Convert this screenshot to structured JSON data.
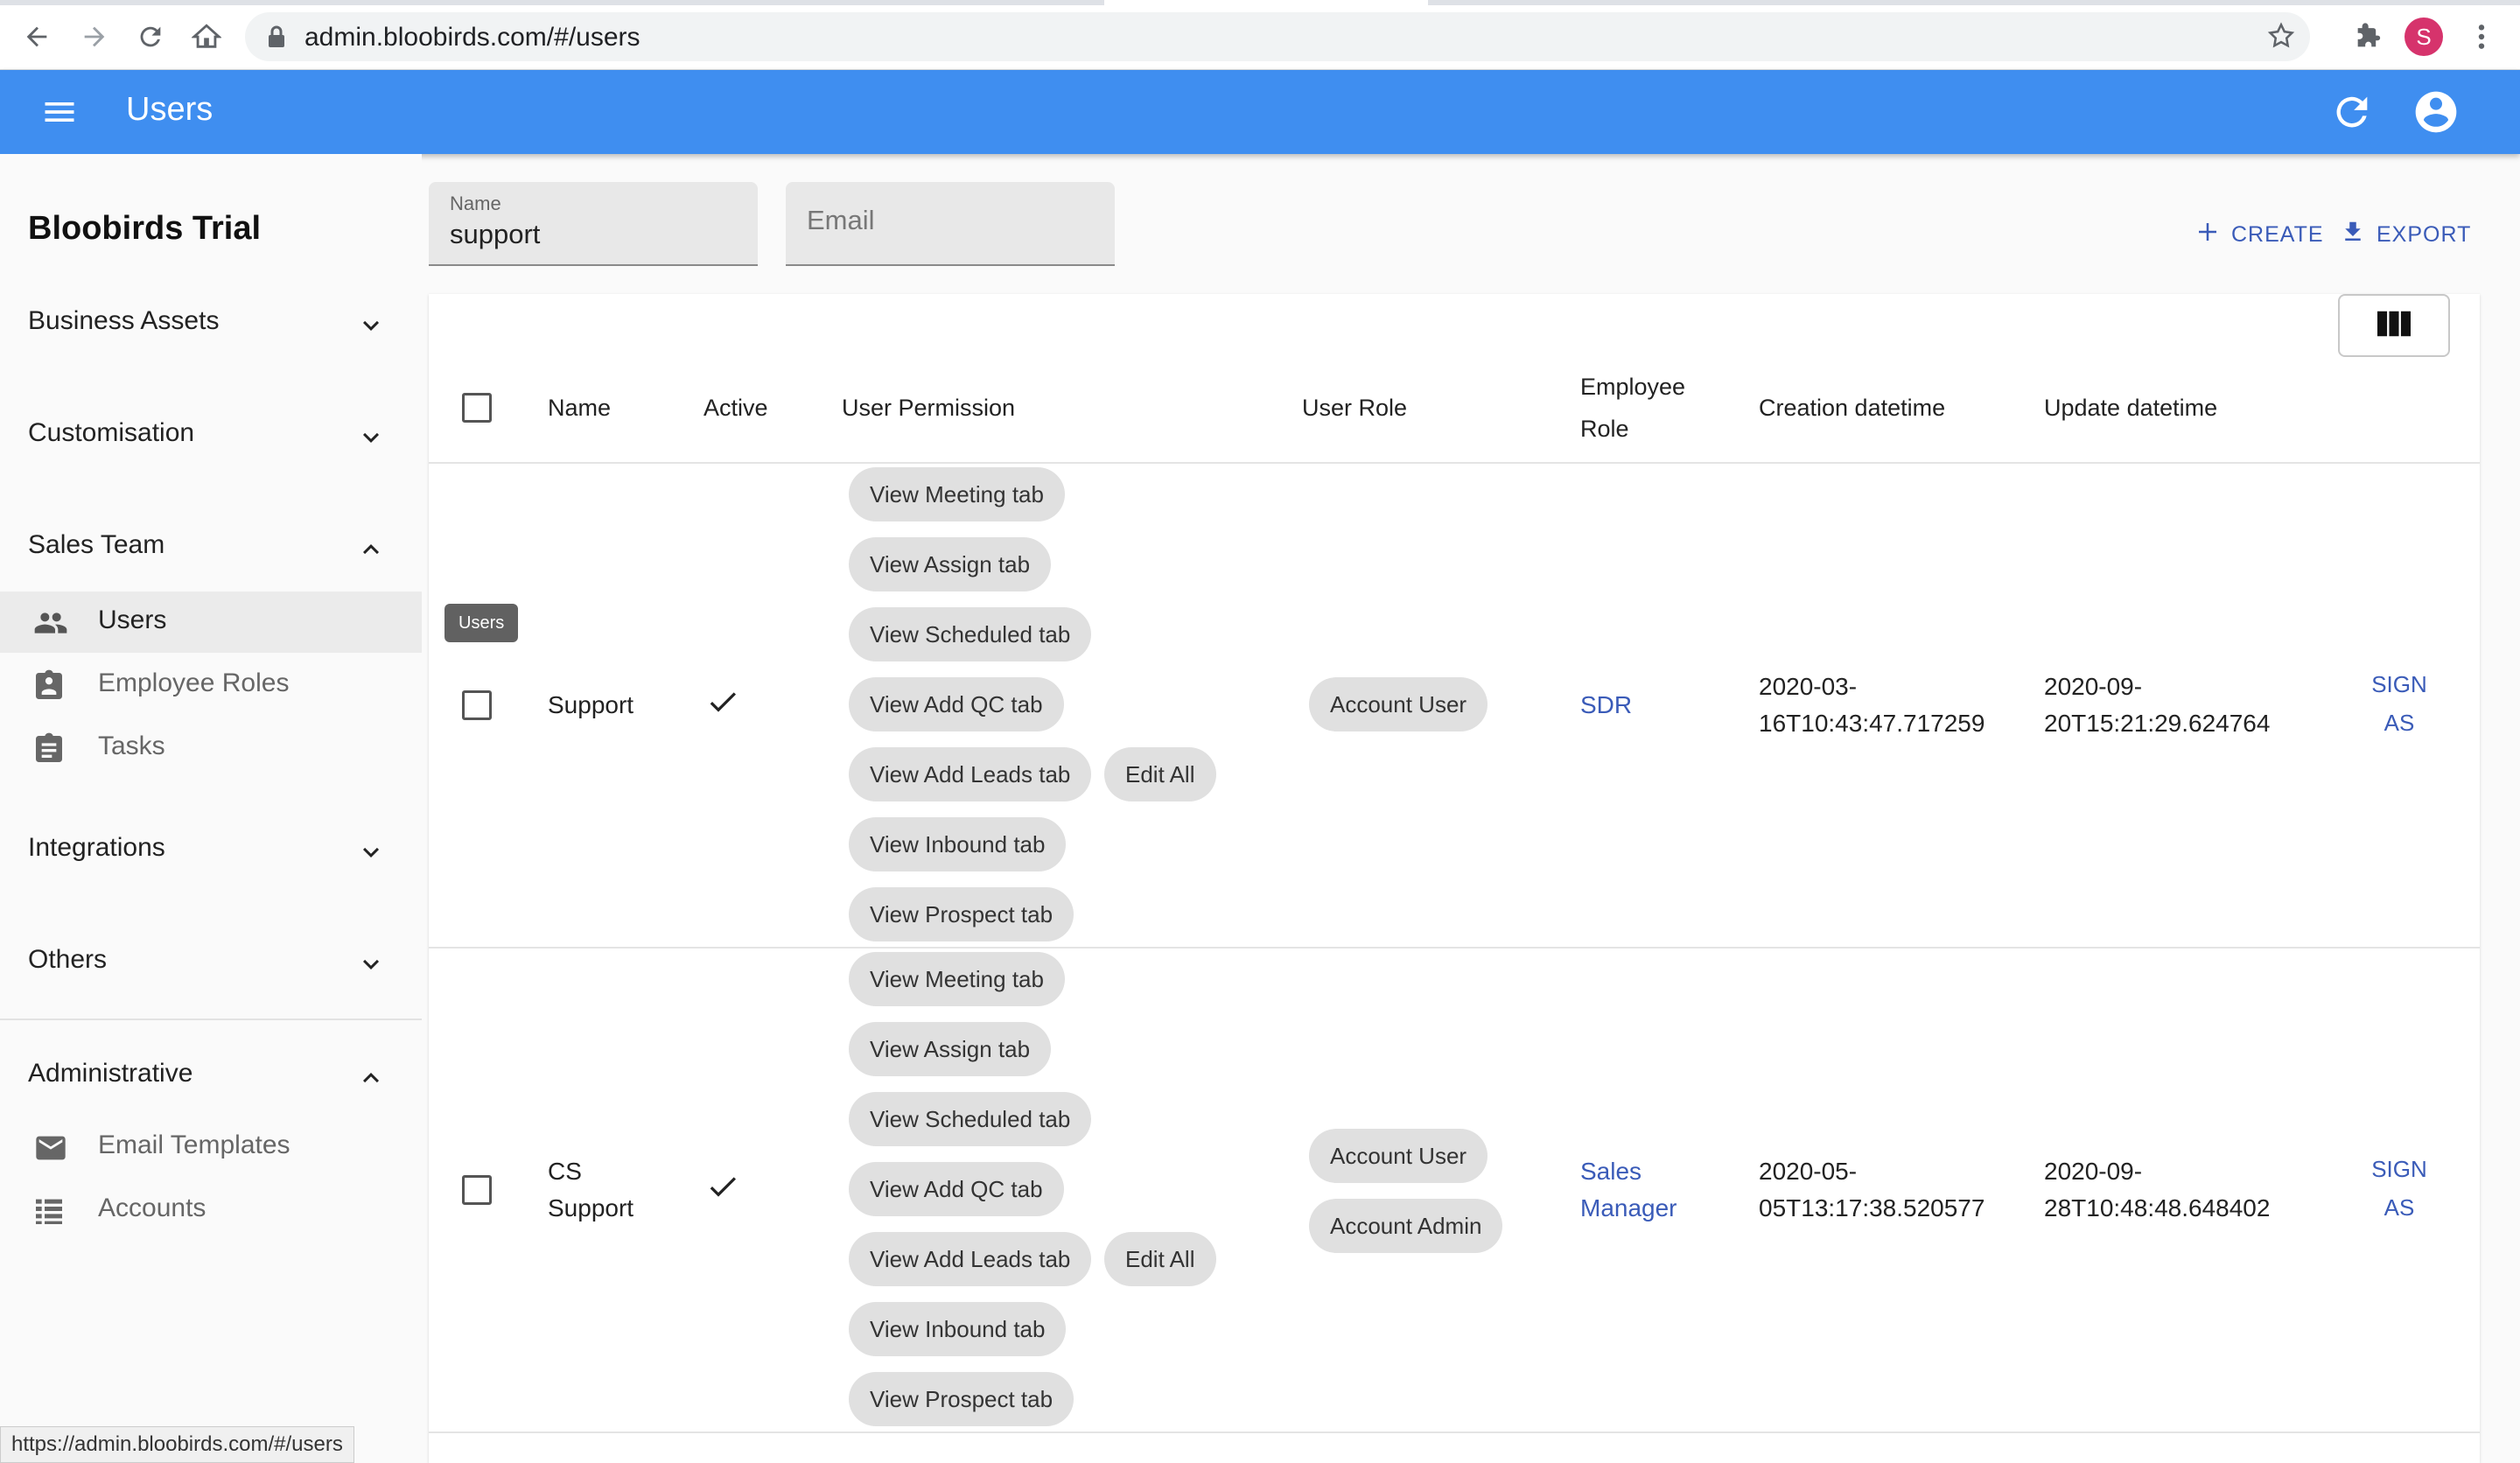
{
  "browser": {
    "url": "admin.bloobirds.com/#/users",
    "profile_initial": "S",
    "status_url": "https://admin.bloobirds.com/#/users"
  },
  "appbar": {
    "title": "Users"
  },
  "sidebar": {
    "brand": "Bloobirds Trial",
    "groups": {
      "business_assets": "Business Assets",
      "customisation": "Customisation",
      "sales_team": "Sales Team",
      "integrations": "Integrations",
      "others": "Others",
      "administrative": "Administrative"
    },
    "items": {
      "users": "Users",
      "employee_roles": "Employee Roles",
      "tasks": "Tasks",
      "email_templates": "Email Templates",
      "accounts": "Accounts"
    }
  },
  "filters": {
    "name_label": "Name",
    "name_value": "support",
    "email_placeholder": "Email"
  },
  "actions": {
    "create": "CREATE",
    "export": "EXPORT"
  },
  "table": {
    "headers": {
      "name": "Name",
      "active": "Active",
      "permission": "User Permission",
      "role": "User Role",
      "employee_role_1": "Employee",
      "employee_role_2": "Role",
      "created": "Creation datetime",
      "updated": "Update datetime"
    },
    "rows": [
      {
        "name_1": "Support",
        "active": true,
        "permissions": [
          "View Meeting tab",
          "View Assign tab",
          "View Scheduled tab",
          "View Add QC tab",
          "View Add Leads tab",
          "Edit All",
          "View Inbound tab",
          "View Prospect tab"
        ],
        "roles": [
          "Account User"
        ],
        "employee_role_1": "SDR",
        "created_1": "2020-03-",
        "created_2": "16T10:43:47.717259",
        "updated_1": "2020-09-",
        "updated_2": "20T15:21:29.624764",
        "sign_1": "SIGN",
        "sign_2": "AS"
      },
      {
        "name_1": "CS",
        "name_2": "Support",
        "active": true,
        "permissions": [
          "View Meeting tab",
          "View Assign tab",
          "View Scheduled tab",
          "View Add QC tab",
          "View Add Leads tab",
          "Edit All",
          "View Inbound tab",
          "View Prospect tab"
        ],
        "roles": [
          "Account User",
          "Account Admin"
        ],
        "employee_role_1": "Sales",
        "employee_role_2": "Manager",
        "created_1": "2020-05-",
        "created_2": "05T13:17:38.520577",
        "updated_1": "2020-09-",
        "updated_2": "28T10:48:48.648402",
        "sign_1": "SIGN",
        "sign_2": "AS"
      }
    ]
  },
  "tooltip": "Users",
  "colors": {
    "appbar": "#3f8ef0",
    "link": "#3a5bb8"
  }
}
